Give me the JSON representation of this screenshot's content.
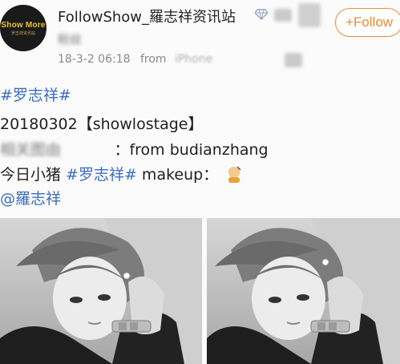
{
  "post": {
    "avatar_text": "Show More",
    "avatar_subtext": "罗志祥资讯站",
    "username": "FollowShow_羅志祥资讯站",
    "follow_label": "+Follow",
    "subtitle": "粉丝",
    "timestamp": "18-3-2 06:18",
    "from_label": "from",
    "source_blurred": "iPhone"
  },
  "content": {
    "topic_tag": "#罗志祥#",
    "line2": "20180302【showlostage】",
    "line3_blurred": "相关图由",
    "line3_visible": "：from budianzhang",
    "line4_prefix": "今日小猪 ",
    "line4_tag": "#罗志祥#",
    "line4_suffix": " makeup：",
    "mention": "@羅志祥"
  },
  "icons": {
    "verify": "diamond-verify-icon",
    "emoji": "haircut-person-emoji-icon"
  },
  "colors": {
    "accent": "#f08a3a",
    "link": "#3b6fc6"
  }
}
